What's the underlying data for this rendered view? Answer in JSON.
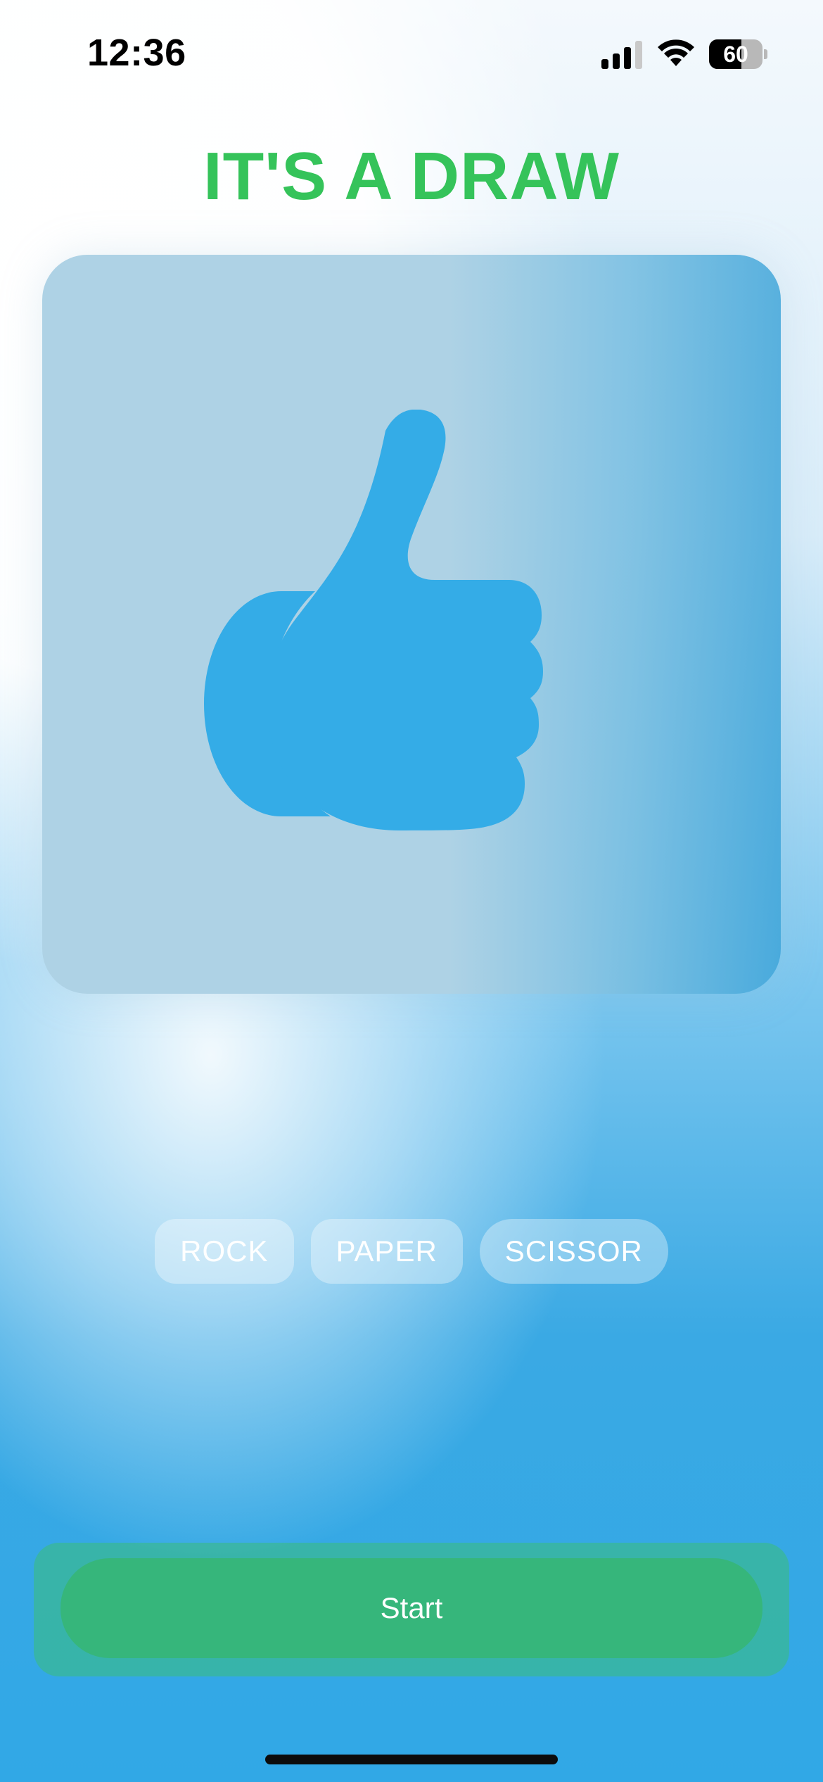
{
  "status_bar": {
    "time": "12:36",
    "battery": "60",
    "battery_level": 0.6,
    "signal_bars": 3
  },
  "result": {
    "title": "IT'S A DRAW",
    "icon": "thumbs-up-icon",
    "title_color": "#35c35a",
    "icon_color": "#34ace7"
  },
  "choices": [
    {
      "label": "ROCK"
    },
    {
      "label": "PAPER"
    },
    {
      "label": "SCISSOR"
    }
  ],
  "start": {
    "label": "Start",
    "color": "#36b67b"
  }
}
